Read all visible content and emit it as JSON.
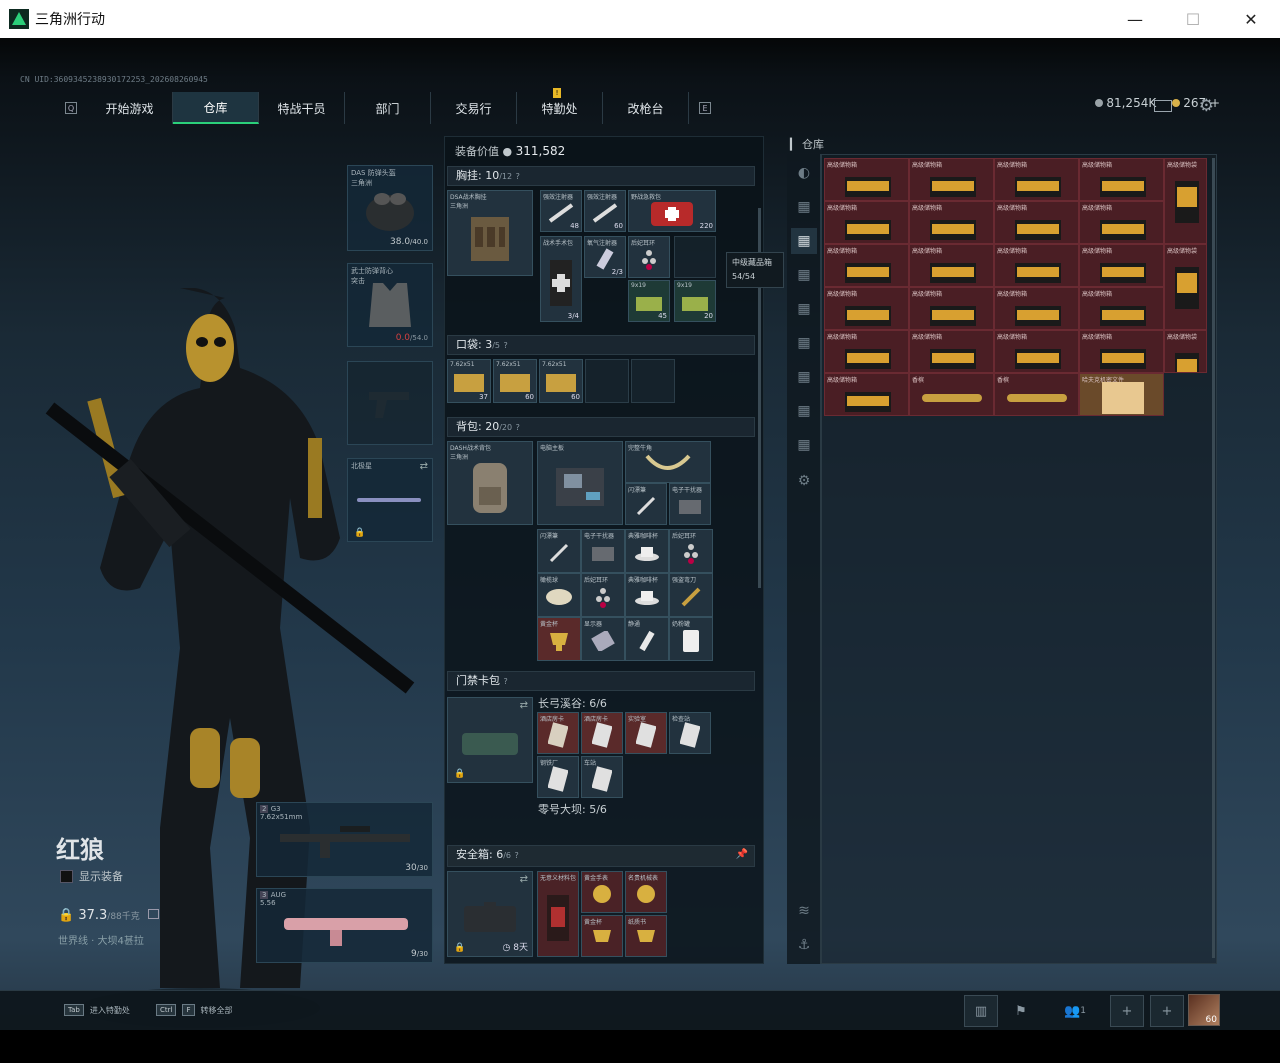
{
  "window": {
    "title": "三角洲行动",
    "minimize": "—",
    "maximize": "☐",
    "close": "✕"
  },
  "uid": "CN UID:3609345238930172253_202608260945",
  "nav": {
    "left_key": "Q",
    "right_key": "E",
    "tabs": [
      "开始游戏",
      "仓库",
      "特战干员",
      "部门",
      "交易行",
      "特勤处",
      "改枪台"
    ],
    "active": "仓库",
    "badge": "!"
  },
  "currency": {
    "silver": "81,254K",
    "gold": "267",
    "plus": "+"
  },
  "character": {
    "name": "红狼",
    "show_gear": "显示装备",
    "weight": "37.3",
    "weight_max": "/88千克",
    "map_status": "世界线 · 大坝4甚拉"
  },
  "equipment": {
    "helmet": {
      "label": "DAS 防弹头盔\n三角洲",
      "value": "38.0",
      "max": "/40.0"
    },
    "armor": {
      "label": "武士防弹背心\n突击",
      "value": "0.0",
      "max": "/54.0"
    },
    "melee": {
      "label": "北极星"
    },
    "primary": {
      "num": "2",
      "name": "G3",
      "caliber": "7.62x51mm",
      "ammo": "30",
      "ammo_max": "/30"
    },
    "secondary": {
      "num": "3",
      "name": "AUG",
      "caliber": "5.56",
      "ammo": "9",
      "ammo_max": "/30"
    }
  },
  "loadout": {
    "value_label": "装备价值",
    "value": "311,582",
    "chest_rig": {
      "title": "胸挂:",
      "count": "10",
      "max": "/12",
      "help": "?",
      "rig_name": "DSA战术胸挂\n三角洲"
    },
    "chest_items": [
      {
        "name": "强效注射器",
        "qty": "48"
      },
      {
        "name": "强效注射器",
        "qty": "60"
      },
      {
        "name": "野战急救包",
        "qty": "220"
      },
      {
        "name": "战术手术包",
        "qty": "3/4"
      },
      {
        "name": "氧气注射器",
        "qty": "2/3"
      },
      {
        "name": "后妃耳环",
        "qty": ""
      },
      {
        "name": "9x19",
        "qty": "45"
      },
      {
        "name": "9x19",
        "qty": "20"
      }
    ],
    "pocket": {
      "title": "口袋:",
      "count": "3",
      "max": "/5",
      "help": "?",
      "items": [
        {
          "name": "7.62x51",
          "qty": "37"
        },
        {
          "name": "7.62x51",
          "qty": "60"
        },
        {
          "name": "7.62x51",
          "qty": "60"
        }
      ]
    },
    "backpack": {
      "title": "背包:",
      "count": "20",
      "max": "/20",
      "help": "?",
      "bag_name": "DASH战术背包\n三角洲",
      "items": [
        "电脑主板",
        "完整牛角",
        "闪漂筆",
        "电子干扰器",
        "闪漂筆",
        "电子干扰器",
        "典雅咖啡杯",
        "后妃耳环",
        "橄榄球",
        "后妃耳环",
        "典雅咖啡杯",
        "强盗弯刀",
        "黄金杯",
        "显示器",
        "静通",
        "奶粉罐"
      ]
    },
    "keycase": {
      "title": "门禁卡包",
      "help": "?",
      "map1": "长弓溪谷: 6/6",
      "map2": "零号大坝: 5/6",
      "cards": [
        "酒店房卡",
        "酒店房卡",
        "实验室",
        "检查站",
        "钢铁厂",
        "车站"
      ]
    },
    "safebox": {
      "title": "安全箱:",
      "count": "6",
      "max": "/6",
      "help": "?",
      "time": "8天",
      "items": [
        "无意义材料包",
        "黄金手表",
        "名贵机械表",
        "黄金杯",
        "纸质书",
        "黄金杯"
      ]
    }
  },
  "tooltip": {
    "name": "中级藏品箱",
    "qty": "54/54"
  },
  "warehouse": {
    "label": "仓库",
    "cell_names": [
      "高级储物箱",
      "高级储物箱",
      "高级储物箱",
      "高级储物箱",
      "高级储物袋"
    ],
    "last_row": [
      "高级储物箱",
      "香槟",
      "香槟",
      "哈夫克机密文件"
    ]
  },
  "bottom": {
    "hint1_key": "Tab",
    "hint1": "进入特勤处",
    "hint2_key1": "Ctrl",
    "hint2_key2": "F",
    "hint2": "转移全部",
    "friends": "1",
    "level": "60"
  }
}
